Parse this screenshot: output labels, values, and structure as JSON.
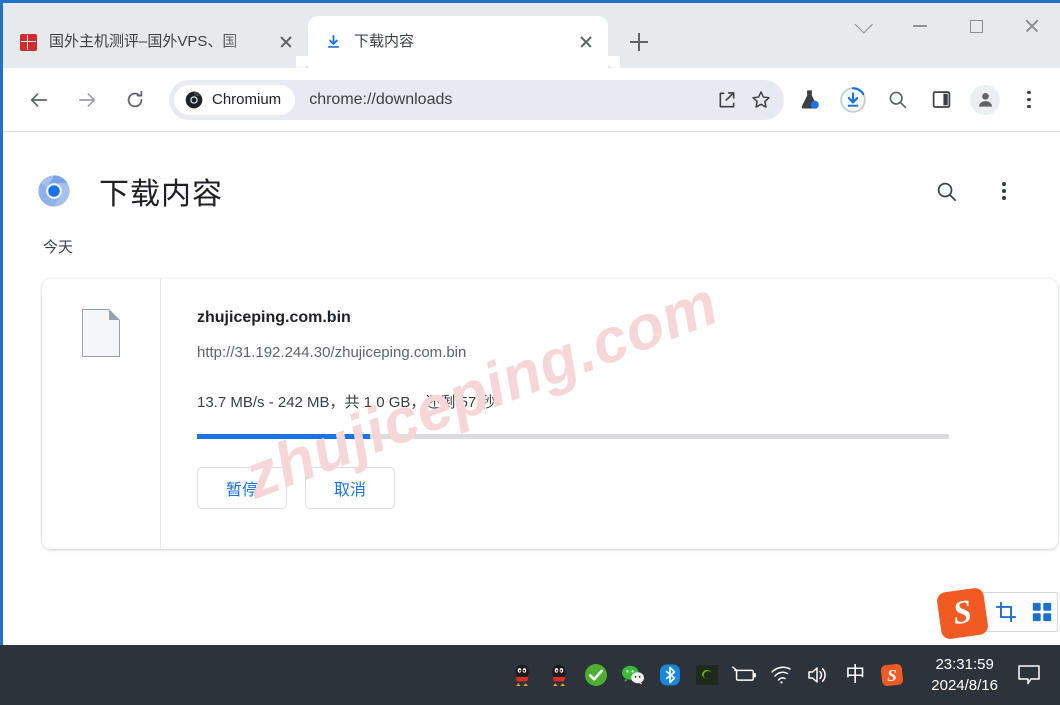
{
  "window": {
    "controls": {
      "tab_search": "tab-search",
      "minimize": "minimize",
      "maximize": "maximize",
      "close": "close"
    }
  },
  "tabs": [
    {
      "title": "国外主机测评–国外VPS、国",
      "favicon": "red-square-favicon",
      "active": false
    },
    {
      "title": "下载内容",
      "favicon": "download-icon",
      "active": true
    }
  ],
  "new_tab_label": "+",
  "toolbar": {
    "back": "back-arrow",
    "forward": "forward-arrow",
    "reload": "reload",
    "chip_label": "Chromium",
    "url": "chrome://downloads",
    "share": "share-icon",
    "bookmark": "star-icon",
    "experiments": "flask-icon",
    "downloads": "download-progress-icon",
    "search": "search-icon",
    "side_panel": "side-panel-icon",
    "profile": "profile-avatar",
    "menu": "three-dot-menu"
  },
  "page": {
    "title": "下载内容",
    "search_icon": "search-icon",
    "menu_icon": "more-vertical-icon",
    "section_label": "今天",
    "watermark": "zhujiceping.com"
  },
  "download": {
    "file_name": "zhujiceping.com.bin",
    "url": "http://31.192.244.30/zhujiceping.com.bin",
    "status": "13.7 MB/s - 242 MB，共 1.0 GB，还剩 57 秒",
    "progress_percent": 23,
    "progress_color": "#1a73e8",
    "buttons": [
      {
        "label": "暂停",
        "name": "pause-button"
      },
      {
        "label": "取消",
        "name": "cancel-button"
      }
    ]
  },
  "capture_toolbar": {
    "logo": "S",
    "crop_icon": "crop-icon",
    "grid_icon": "grid-icon"
  },
  "taskbar": {
    "tray": [
      "qq-penguin-icon",
      "qq-penguin-icon-2",
      "green-check-icon",
      "wechat-icon",
      "bluetooth-icon",
      "nvidia-icon",
      "battery-icon",
      "wifi-icon",
      "volume-icon",
      "ime-chinese-icon",
      "sogou-icon"
    ],
    "ime_char": "中",
    "sogou_char": "S",
    "time": "23:31:59",
    "date": "2024/8/16",
    "notification": "notification-icon"
  }
}
